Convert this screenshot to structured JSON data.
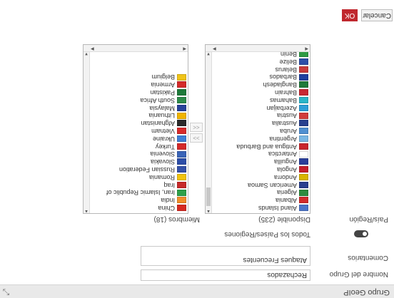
{
  "window": {
    "title": "Grupo GeoIP"
  },
  "form": {
    "name_label": "Nombre del Grupo",
    "name_value": "Rechazados",
    "comments_label": "Comentarios",
    "comments_value": "Ataques Frecuentes",
    "all_countries_label": "Todos los Países/Regiones",
    "country_label": "País/Región"
  },
  "available": {
    "header": "Disponible (235)",
    "items": [
      {
        "name": "Aland Islands",
        "flag": "#4a74c9"
      },
      {
        "name": "Albania",
        "flag": "#d22b2b"
      },
      {
        "name": "Algeria",
        "flag": "#2e8b3e"
      },
      {
        "name": "American Samoa",
        "flag": "#2a3f8f"
      },
      {
        "name": "Andorra",
        "flag": "#d8b400"
      },
      {
        "name": "Angola",
        "flag": "#c61f2b"
      },
      {
        "name": "Anguilla",
        "flag": "#2b3f9a"
      },
      {
        "name": "Antarctica",
        "flag": "#ffffff"
      },
      {
        "name": "Antigua and Barbuda",
        "flag": "#c8262d"
      },
      {
        "name": "Argentina",
        "flag": "#79b7e4"
      },
      {
        "name": "Aruba",
        "flag": "#4f8fd1"
      },
      {
        "name": "Australia",
        "flag": "#283f8e"
      },
      {
        "name": "Austria",
        "flag": "#d13c3c"
      },
      {
        "name": "Azerbaijan",
        "flag": "#2e9fd8"
      },
      {
        "name": "Bahamas",
        "flag": "#2ab5c8"
      },
      {
        "name": "Bahrain",
        "flag": "#c82832"
      },
      {
        "name": "Bangladesh",
        "flag": "#1f7a3a"
      },
      {
        "name": "Barbados",
        "flag": "#1f3f9f"
      },
      {
        "name": "Belarus",
        "flag": "#c83a3a"
      },
      {
        "name": "Belize",
        "flag": "#2d4ea8"
      },
      {
        "name": "Benin",
        "flag": "#2e9a44"
      }
    ]
  },
  "members": {
    "header": "Miembros (18)",
    "items": [
      {
        "name": "China",
        "flag": "#d62a21"
      },
      {
        "name": "India",
        "flag": "#f08f2a"
      },
      {
        "name": "Iran, Islamic Republic of",
        "flag": "#2ea14a"
      },
      {
        "name": "Iraq",
        "flag": "#c72a2a"
      },
      {
        "name": "Romania",
        "flag": "#f1c40f"
      },
      {
        "name": "Russian Federation",
        "flag": "#3451a8"
      },
      {
        "name": "Slovakia",
        "flag": "#2d4ea8"
      },
      {
        "name": "Slovenia",
        "flag": "#3a64b8"
      },
      {
        "name": "Turkey",
        "flag": "#d42a2a"
      },
      {
        "name": "Ukraine",
        "flag": "#3d7fd6"
      },
      {
        "name": "Vietnam",
        "flag": "#d82b2b"
      },
      {
        "name": "Afghanistan",
        "flag": "#2a2a2a"
      },
      {
        "name": "Lithuania",
        "flag": "#f0b400"
      },
      {
        "name": "Malaysia",
        "flag": "#28429a"
      },
      {
        "name": "South Africa",
        "flag": "#2e8b4a"
      },
      {
        "name": "Pakistan",
        "flag": "#1e7a3a"
      },
      {
        "name": "Armenia",
        "flag": "#d42a2a"
      },
      {
        "name": "Belgium",
        "flag": "#f0c419"
      }
    ]
  },
  "transfer": {
    "add_label": ">>",
    "remove_label": "<<"
  },
  "footer": {
    "cancel_label": "Cancelar",
    "ok_label": "OK"
  },
  "colors": {
    "ok_button": "#c0272d"
  },
  "icons": {
    "close": "resize-icon"
  }
}
